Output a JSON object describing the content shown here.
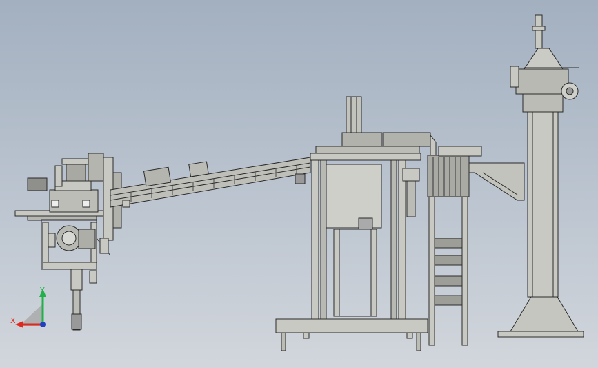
{
  "viewport": {
    "background_top": "#a3b0c0",
    "background_bottom": "#d2d6dc"
  },
  "triad": {
    "x_label": "X",
    "y_label": "Y",
    "x_color": "#e0281e",
    "y_color": "#22b04a",
    "z_color": "#2040c0"
  },
  "colors": {
    "steel": "#c9c9c4",
    "steel_dark": "#9a9a96",
    "edge": "#2a2a2a"
  }
}
